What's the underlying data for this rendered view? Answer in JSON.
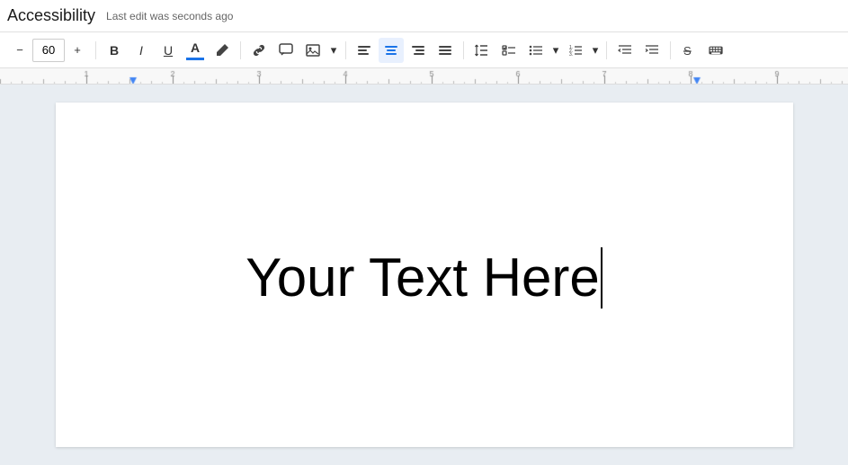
{
  "titleBar": {
    "title": "Accessibility",
    "lastEdit": "Last edit was seconds ago"
  },
  "toolbar": {
    "decreaseFontSize": "−",
    "fontSize": "60",
    "increaseFontSize": "+",
    "bold": "B",
    "italic": "I",
    "underline": "U",
    "textColor": "A",
    "highlightColor": "✏",
    "link": "🔗",
    "insertComment": "💬",
    "insertImage": "🖼",
    "alignLeft": "≡",
    "alignCenter": "≡",
    "alignRight": "≡",
    "alignJustify": "≡",
    "lineSpacing": "↕",
    "checklist": "☑",
    "bulletList": "☰",
    "numberedList": "☰",
    "indentDecrease": "⇤",
    "indentIncrease": "⇥",
    "strikethrough": "S̶",
    "moreOptions": "■"
  },
  "document": {
    "content": "Your Text Here"
  }
}
